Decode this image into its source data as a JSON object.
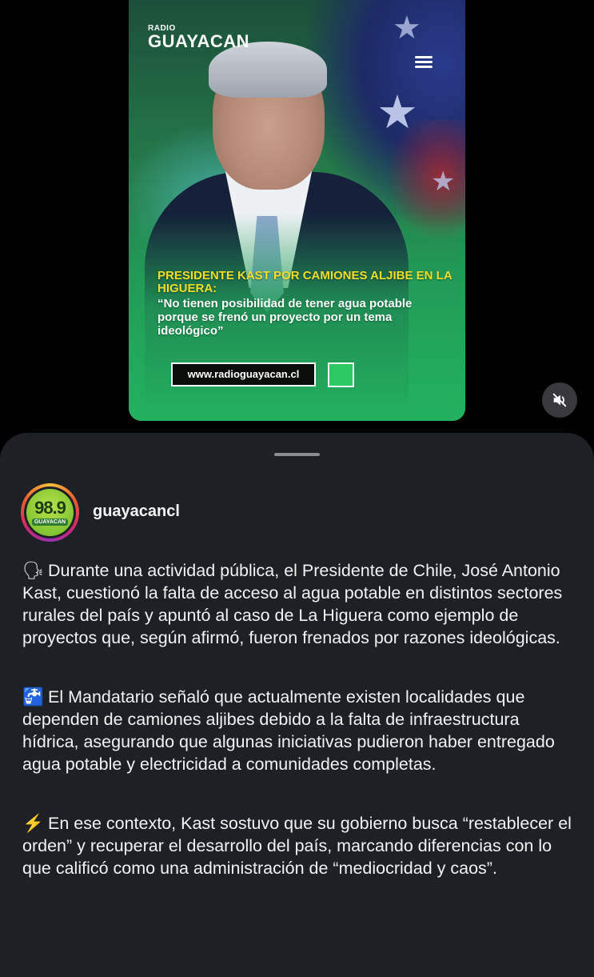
{
  "video": {
    "logo_small": "RADIO",
    "logo_big": "GUAYACAN",
    "headline": "PRESIDENTE KAST POR CAMIONES ALJIBE EN LA HIGUERA:",
    "quote": "“No tienen posibilidad de tener agua potable porque se frenó un proyecto por un tema ideológico”",
    "url": "www.radioguayacan.cl",
    "mute_icon": "speaker-muted-icon"
  },
  "post": {
    "avatar_number": "98.9",
    "avatar_brand": "GUAYACAN",
    "username": "guayacancl",
    "paragraphs": [
      {
        "emoji": "🗣",
        "text": "Durante una actividad pública, el Presidente de Chile, José Antonio Kast, cuestionó la falta de acceso al agua potable en distintos sectores rurales del país y apuntó al caso de La Higuera como ejemplo de proyectos que, según afirmó, fueron frenados por razones ideológicas."
      },
      {
        "emoji": "🚰",
        "text": "El Mandatario señaló que actualmente existen localidades que dependen de camiones aljibes debido a la falta de infraestructura hídrica, asegurando que algunas iniciativas pudieron haber entregado agua potable y electricidad a comunidades completas."
      },
      {
        "emoji": "⚡",
        "text": "En ese contexto, Kast sostuvo que su gobierno busca “restablecer el orden” y recuperar el desarrollo del país, marcando diferencias con lo que calificó como una administración de “mediocridad y caos”."
      }
    ]
  }
}
